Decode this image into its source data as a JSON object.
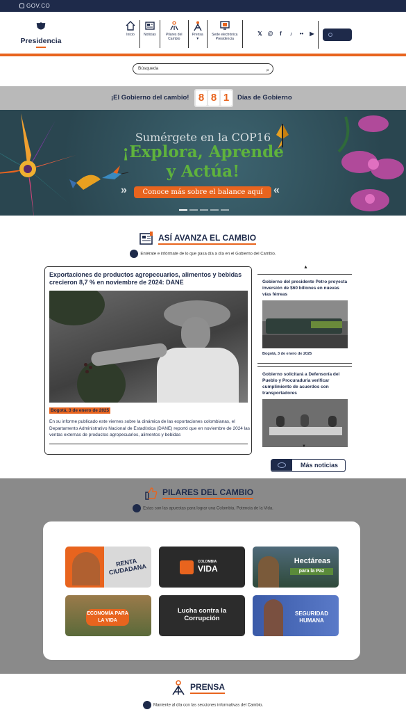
{
  "gov_bar": {
    "label": "GOV.CO"
  },
  "header": {
    "logo_text": "Presidencia",
    "nav": [
      {
        "label": "Inicio",
        "icon": "home-icon"
      },
      {
        "label": "Noticias",
        "icon": "newspaper-icon"
      },
      {
        "label": "Pilares del Cambio",
        "icon": "pillars-icon"
      },
      {
        "label": "Prensa",
        "icon": "press-icon"
      },
      {
        "label": "Sede electrónica Presidencia",
        "icon": "computer-icon"
      }
    ],
    "social": [
      "𝕏",
      "@",
      "f",
      "♪",
      "••",
      "▶"
    ]
  },
  "search": {
    "placeholder": "Búsqueda"
  },
  "counter": {
    "left_label": "¡El Gobierno del cambio!",
    "digits": [
      "8",
      "8",
      "1"
    ],
    "right_label": "Días de Gobierno"
  },
  "banner": {
    "subtitle": "Sumérgete en la COP16",
    "title_line1": "¡Explora, Aprende",
    "title_line2": "y Actúa!",
    "cta": "Conoce más sobre el balance aquí"
  },
  "avanza": {
    "title": "ASÍ AVANZA EL CAMBIO",
    "subtitle": "Entérate e infórmate de lo que pasa día a día en el Gobierno del Cambio."
  },
  "main_news": {
    "headline": "Exportaciones de productos agropecuarios, alimentos y bebidas crecieron 8,7 % en noviembre de 2024: DANE",
    "date": "Bogotá, 3 de enero de 2025",
    "summary": "En su informe publicado este viernes sobre la dinámica de las exportaciones colombianas, el Departamento Administrativo Nacional de Estadística (DANE) reportó que en noviembre de 2024 las ventas externas de productos agropecuarios, alimentos y bebidas"
  },
  "side_news": [
    {
      "headline": "Gobierno del presidente Petro proyecta inversión de $60 billones en nuevas vías férreas",
      "date": "Bogotá, 3 de enero de 2025"
    },
    {
      "headline": "Gobierno solicitará a Defensoría del Pueblo y Procuraduría verificar cumplimiento de acuerdos con transportadores",
      "date": ""
    }
  ],
  "more_news": {
    "label": "Más noticias"
  },
  "pilares": {
    "title": "PILARES DEL CAMBIO",
    "subtitle": "Estas son las apuestas para lograr una Colombia, Potencia de la Vida.",
    "tiles": [
      {
        "label": "RENTA CIUDADANA"
      },
      {
        "label_small": "COLOMBIA",
        "label": "VIDA"
      },
      {
        "label": "Hectáreas",
        "label_small": "para la Paz"
      },
      {
        "label": "ECONOMÍA PARA LA VIDA"
      },
      {
        "label": "Lucha contra la Corrupción"
      },
      {
        "label": "SEGURIDAD HUMANA"
      }
    ]
  },
  "prensa": {
    "title": "PRENSA",
    "subtitle": "Mantente al día con las secciones informativas del Cambio."
  },
  "colors": {
    "navy": "#1e2a4a",
    "orange": "#e8641e"
  }
}
